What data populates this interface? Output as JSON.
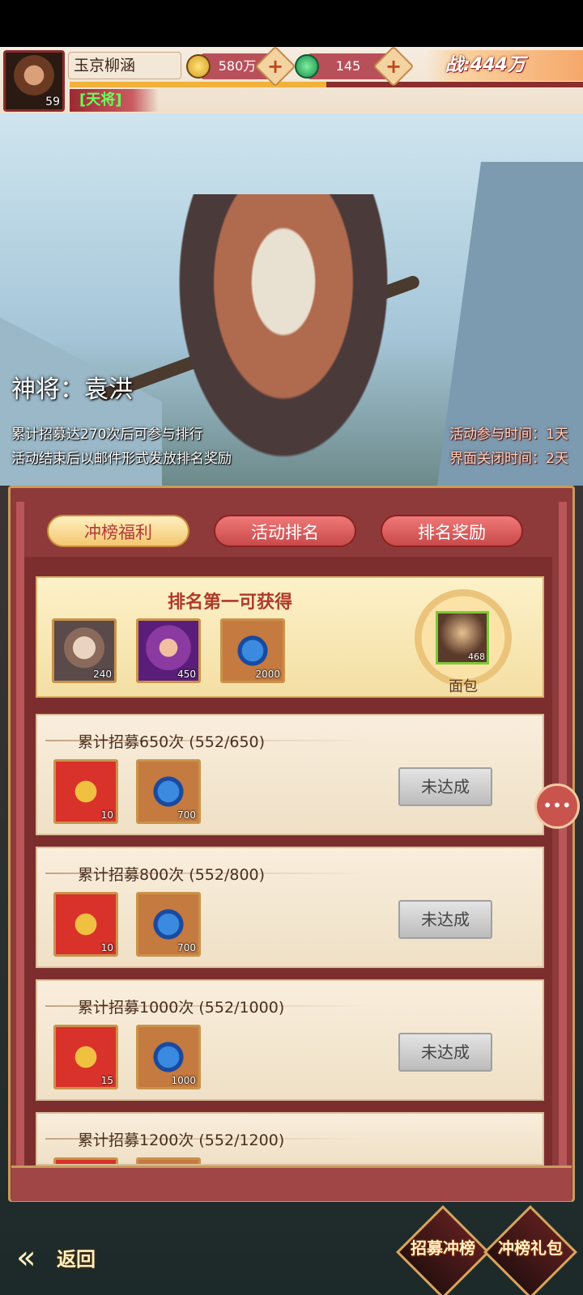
{
  "player": {
    "name": "玉京柳涵",
    "level": "59",
    "title": "[天将]",
    "xp_fraction": 0.5
  },
  "currencies": {
    "gold": "580万",
    "jade": "145"
  },
  "power": "战:444万",
  "hero": {
    "name": "神将：袁洪",
    "info_1": "累计招募达270次后可参与排行",
    "info_2": "活动结束后以邮件形式发放排名奖励",
    "time_1": "活动参与时间：1天",
    "time_2": "界面关闭时间：2天"
  },
  "tabs": [
    {
      "label": "冲榜福利",
      "active": true
    },
    {
      "label": "活动排名",
      "active": false
    },
    {
      "label": "排名奖励",
      "active": false
    }
  ],
  "first_place": {
    "title": "排名第一可获得",
    "items": [
      {
        "icon": "hero-fragment-icon",
        "count": "240"
      },
      {
        "icon": "purple-hero-fragment-icon",
        "count": "450"
      },
      {
        "icon": "blue-gem-icon",
        "count": "2000"
      }
    ],
    "top_player_name": "面包",
    "top_player_level": "468"
  },
  "tasks": [
    {
      "label": "累计招募650次 (552/650)",
      "items": [
        {
          "icon": "red-bag-icon",
          "count": "10"
        },
        {
          "icon": "blue-gem-icon",
          "count": "700"
        }
      ],
      "button": "未达成"
    },
    {
      "label": "累计招募800次 (552/800)",
      "items": [
        {
          "icon": "red-bag-icon",
          "count": "10"
        },
        {
          "icon": "blue-gem-icon",
          "count": "700"
        }
      ],
      "button": "未达成"
    },
    {
      "label": "累计招募1000次 (552/1000)",
      "items": [
        {
          "icon": "red-bag-icon",
          "count": "15"
        },
        {
          "icon": "blue-gem-icon",
          "count": "1000"
        }
      ],
      "button": "未达成"
    },
    {
      "label": "累计招募1200次 (552/1200)",
      "items": [
        {
          "icon": "red-bag-icon",
          "count": ""
        },
        {
          "icon": "blue-gem-icon",
          "count": ""
        }
      ],
      "button": ""
    }
  ],
  "nav": {
    "back": "返回",
    "recruit_rank": "招募冲榜",
    "rank_gift": "冲榜礼包"
  },
  "colors": {
    "panel": "#8e3a3a",
    "accent_gold": "#c99b5c",
    "title_red": "#b0392a"
  }
}
